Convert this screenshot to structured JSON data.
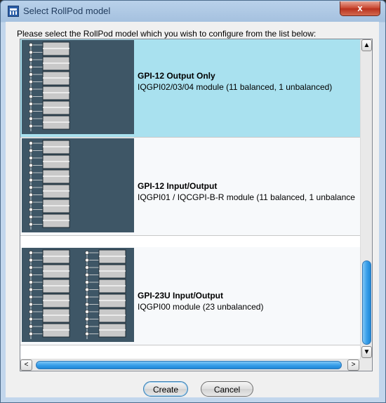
{
  "window": {
    "title": "Select RollPod model",
    "close_label": "x"
  },
  "prompt": "Please select the RollPod model which you wish to configure from the list below:",
  "models": [
    {
      "name": "GPI-12 Output Only",
      "description": "IQGPI02/03/04 module (11 balanced, 1 unbalanced)",
      "selected": true,
      "columns": 1
    },
    {
      "name": "GPI-12 Input/Output",
      "description": "IQGPI01 / IQCGPI-B-R module (11 balanced, 1 unbalance",
      "selected": false,
      "columns": 1
    },
    {
      "name": "GPI-23U Input/Output",
      "description": "IQGPI00 module (23 unbalanced)",
      "selected": false,
      "columns": 2
    }
  ],
  "scrollbars": {
    "up_arrow": "▲",
    "down_arrow": "▼",
    "left_arrow": "<",
    "right_arrow": ">",
    "vertical_position": 1.0,
    "horizontal_position": 0.0
  },
  "buttons": {
    "create": "Create",
    "cancel": "Cancel"
  },
  "colors": {
    "selected_row": "#a9e1ef",
    "thumbnail_bg": "#3e5666",
    "scroll_thumb": "#3ba0ea"
  }
}
